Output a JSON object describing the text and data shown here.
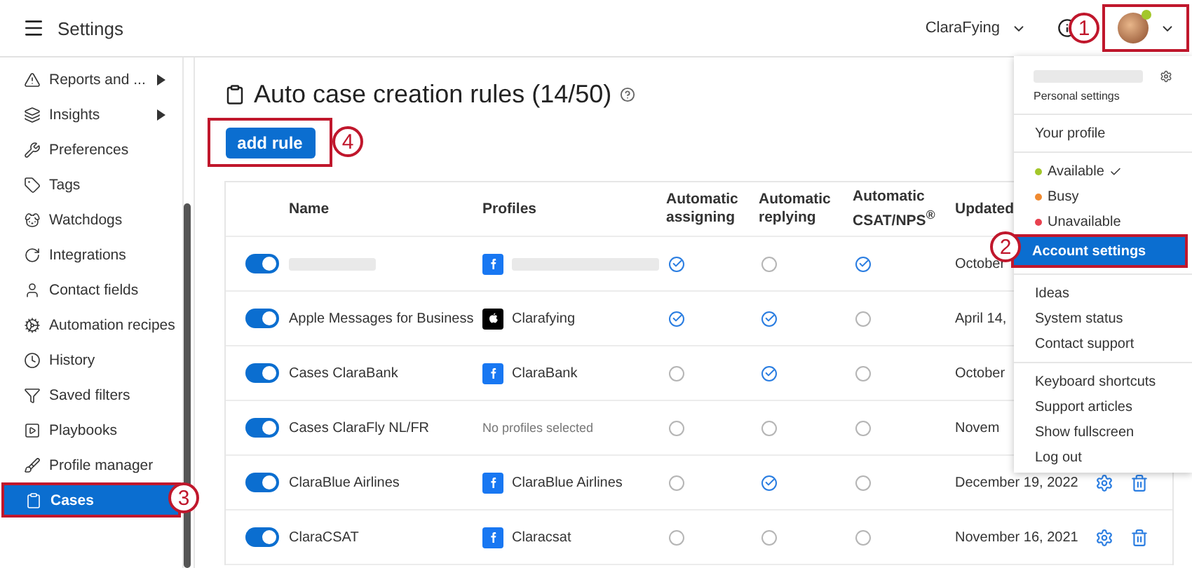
{
  "topbar": {
    "title": "Settings",
    "account": "ClaraFying",
    "avatar_callout": "1"
  },
  "sidebar": {
    "items": [
      {
        "label": "Reports and ...",
        "submenu": true,
        "selected": false
      },
      {
        "label": "Insights",
        "submenu": true,
        "selected": false
      },
      {
        "label": "Preferences",
        "submenu": false,
        "selected": false
      },
      {
        "label": "Tags",
        "submenu": false,
        "selected": false
      },
      {
        "label": "Watchdogs",
        "submenu": false,
        "selected": false
      },
      {
        "label": "Integrations",
        "submenu": false,
        "selected": false
      },
      {
        "label": "Contact fields",
        "submenu": false,
        "selected": false
      },
      {
        "label": "Automation recipes",
        "submenu": false,
        "selected": false
      },
      {
        "label": "History",
        "submenu": false,
        "selected": false
      },
      {
        "label": "Saved filters",
        "submenu": false,
        "selected": false
      },
      {
        "label": "Playbooks",
        "submenu": false,
        "selected": false
      },
      {
        "label": "Profile manager",
        "submenu": false,
        "selected": false
      },
      {
        "label": "Cases",
        "submenu": false,
        "selected": true,
        "callout": "3"
      }
    ]
  },
  "page": {
    "title": "Auto case creation rules (14/50)",
    "add_button": "add rule",
    "add_callout": "4"
  },
  "table": {
    "columns": [
      "Name",
      "Profiles",
      "Automatic assigning",
      "Automatic replying",
      "Automatic CSAT/NPS$^{®}$",
      "Updated"
    ],
    "rows": [
      {
        "on": true,
        "name_hidden": true,
        "profile": {
          "kind": "facebook",
          "hidden": true
        },
        "assigning": true,
        "replying": false,
        "csat": true,
        "updated": "October"
      },
      {
        "on": true,
        "name": "Apple Messages for Business",
        "profile": {
          "kind": "apple",
          "text": "Clarafying"
        },
        "assigning": true,
        "replying": true,
        "csat": false,
        "updated": "April 14,"
      },
      {
        "on": true,
        "name": "Cases ClaraBank",
        "profile": {
          "kind": "facebook",
          "text": "ClaraBank"
        },
        "assigning": false,
        "replying": true,
        "csat": false,
        "updated": "October"
      },
      {
        "on": true,
        "name": "Cases ClaraFly NL/FR",
        "profile": {
          "kind": "none",
          "text": "No profiles selected"
        },
        "assigning": false,
        "replying": false,
        "csat": false,
        "updated": "Novem"
      },
      {
        "on": true,
        "name": "ClaraBlue Airlines",
        "profile": {
          "kind": "facebook",
          "text": "ClaraBlue Airlines"
        },
        "assigning": false,
        "replying": true,
        "csat": false,
        "updated": "December 19, 2022",
        "actions": true
      },
      {
        "on": true,
        "name": "ClaraCSAT",
        "profile": {
          "kind": "facebook",
          "text": "Claracsat"
        },
        "assigning": false,
        "replying": false,
        "csat": false,
        "updated": "November 16, 2021",
        "actions": true
      }
    ]
  },
  "menu": {
    "subtitle": "Personal settings",
    "sections": [
      [
        {
          "label": "Your profile",
          "selected": false
        }
      ],
      [
        {
          "label": "Available",
          "color": "#a3c72a",
          "checked": true
        },
        {
          "label": "Busy",
          "color": "#f08a30",
          "checked": false
        },
        {
          "label": "Unavailable",
          "color": "#e8414f",
          "checked": false
        },
        {
          "label": "Account settings",
          "selected": true,
          "callout": "2"
        }
      ],
      [
        {
          "label": "Ideas",
          "selected": false
        },
        {
          "label": "System status",
          "selected": false
        },
        {
          "label": "Contact support",
          "selected": false
        }
      ],
      [
        {
          "label": "Keyboard shortcuts",
          "selected": false
        },
        {
          "label": "Support articles",
          "selected": false
        },
        {
          "label": "Show fullscreen",
          "selected": false
        },
        {
          "label": "Log out",
          "selected": false
        }
      ]
    ]
  }
}
